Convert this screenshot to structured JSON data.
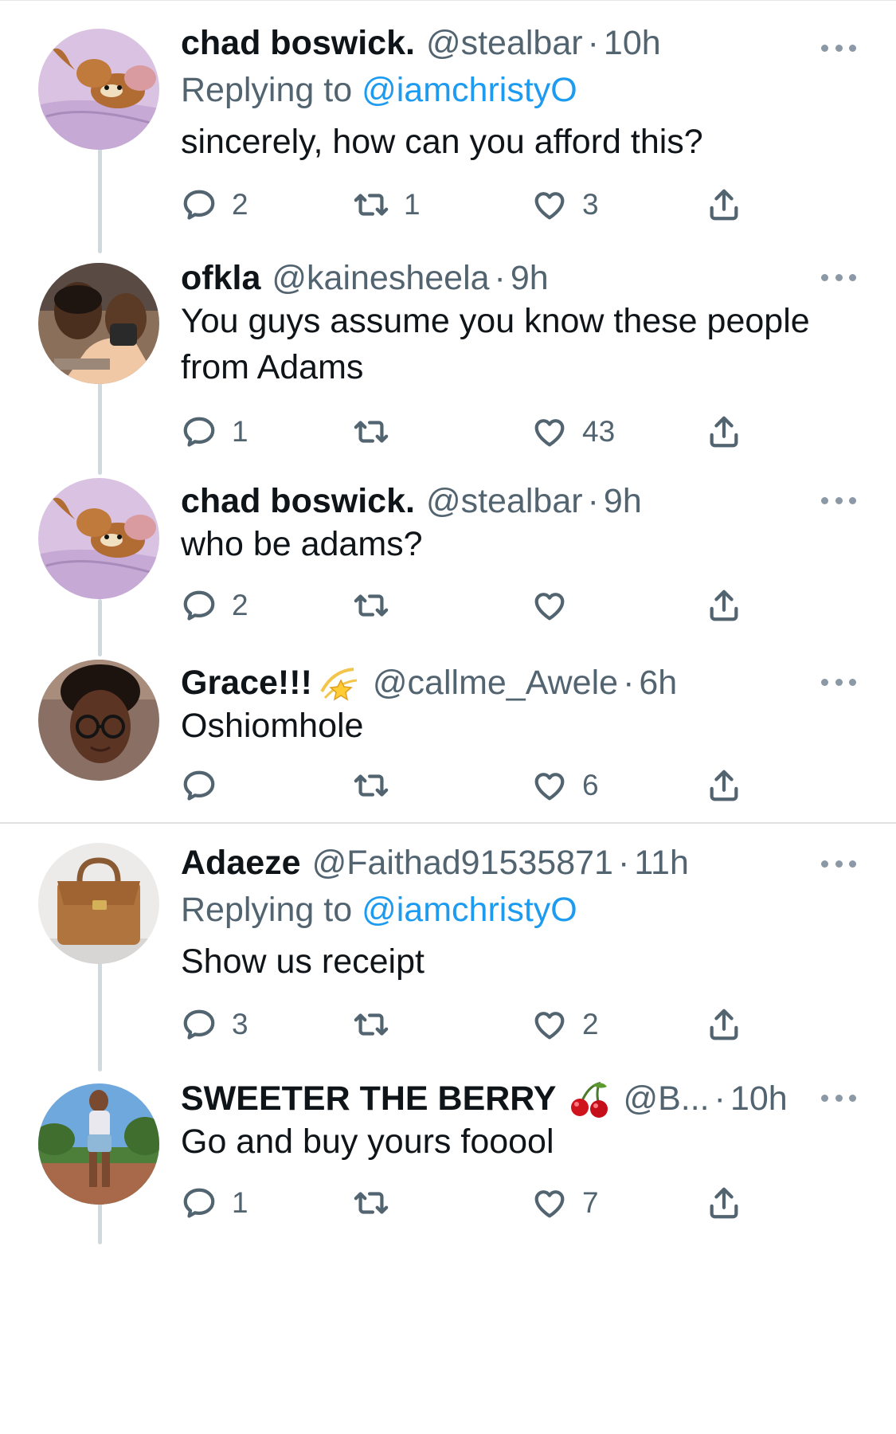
{
  "tweets": [
    {
      "name": "chad boswick.",
      "handle": "@stealbar",
      "time": "10h",
      "replying_prefix": "Replying to",
      "replying_mention": "@iamchristyO",
      "text": "sincerely, how can you afford this?",
      "replies": "2",
      "retweets": "1",
      "likes": "3",
      "avatar": "cartoon-mouse-in-bed"
    },
    {
      "name": "ofkla",
      "handle": "@kainesheela",
      "time": "9h",
      "text_lines": [
        "You guys assume you know these people",
        "from Adams"
      ],
      "replies": "1",
      "retweets": "",
      "likes": "43",
      "avatar": "two-men-photo"
    },
    {
      "name": "chad boswick.",
      "handle": "@stealbar",
      "time": "9h",
      "text": "who be adams?",
      "replies": "2",
      "retweets": "",
      "likes": "",
      "avatar": "cartoon-mouse-in-bed"
    },
    {
      "name": "Grace!!!",
      "name_emoji": "dizzy-star",
      "handle": "@callme_Awele",
      "time": "6h",
      "text": "Oshiomhole",
      "replies": "",
      "retweets": "",
      "likes": "6",
      "avatar": "woman-with-glasses"
    },
    {
      "name": "Adaeze",
      "handle": "@Faithad91535871",
      "time": "11h",
      "replying_prefix": "Replying to",
      "replying_mention": "@iamchristyO",
      "text": "Show us receipt",
      "replies": "3",
      "retweets": "",
      "likes": "2",
      "avatar": "tan-handbag"
    },
    {
      "name": "SWEETER THE BERRY",
      "name_emoji": "cherries",
      "handle": "@B...",
      "time": "10h",
      "text": "Go and buy yours fooool",
      "replies": "1",
      "retweets": "",
      "likes": "7",
      "avatar": "woman-outdoors"
    }
  ],
  "separator": "·",
  "icons": {
    "reply": "reply-icon",
    "retweet": "retweet-icon",
    "like": "heart-icon",
    "share": "share-icon",
    "more": "more-icon"
  },
  "colors": {
    "link": "#1d9bf0",
    "secondary": "#536471",
    "icon": "#536471",
    "thread_line": "#cfd9de"
  }
}
